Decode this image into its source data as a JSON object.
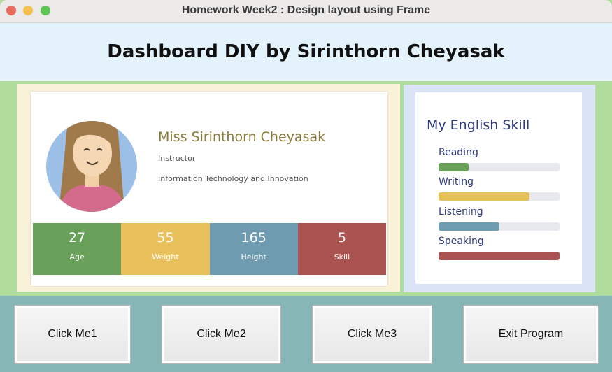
{
  "window": {
    "title": "Homework Week2 : Design layout using Frame"
  },
  "header": {
    "title": "Dashboard DIY by Sirinthorn Cheyasak"
  },
  "profile": {
    "name": "Miss Sirinthorn Cheyasak",
    "role": "Instructor",
    "department": "Information Technology and Innovation",
    "stats": [
      {
        "value": "27",
        "label": "Age",
        "color": "#6aa15a"
      },
      {
        "value": "55",
        "label": "Weight",
        "color": "#e8c15c"
      },
      {
        "value": "165",
        "label": "Height",
        "color": "#6f9bb1"
      },
      {
        "value": "5",
        "label": "Skill",
        "color": "#aa524f"
      }
    ]
  },
  "skills": {
    "title": "My English Skill",
    "items": [
      {
        "name": "Reading",
        "level": 0.25,
        "color": "#6aa15a"
      },
      {
        "name": "Writing",
        "level": 0.75,
        "color": "#e8c15c"
      },
      {
        "name": "Listening",
        "level": 0.5,
        "color": "#6f9bb1"
      },
      {
        "name": "Speaking",
        "level": 1.0,
        "color": "#aa524f"
      }
    ]
  },
  "buttons": {
    "btn1": "Click Me1",
    "btn2": "Click Me2",
    "btn3": "Click Me3",
    "exit": "Exit Program"
  }
}
